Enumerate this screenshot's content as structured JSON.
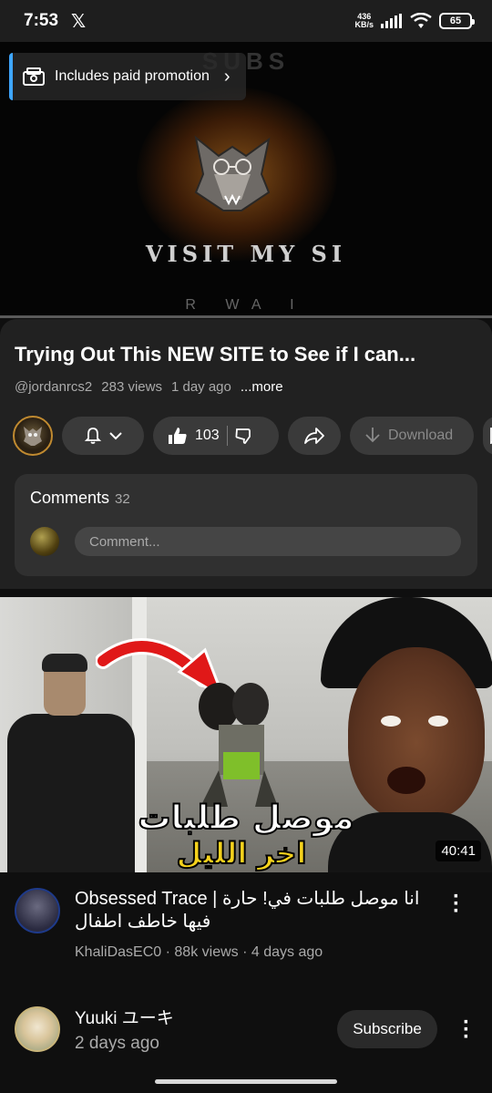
{
  "status_bar": {
    "time": "7:53",
    "x_logo": "𝕏",
    "net_speed_value": "436",
    "net_speed_unit": "KB/s",
    "battery": "65"
  },
  "player": {
    "promo_label": "Includes paid promotion",
    "overlay_top_text": "SUBS",
    "overlay_visit_text": "VISIT MY SI",
    "overlay_bottom_text": "R WA I"
  },
  "video": {
    "title": "Trying Out This NEW SITE to See if I can...",
    "channel_handle": "@jordanrcs2",
    "views": "283 views",
    "age": "1 day ago",
    "more_label": "...more",
    "likes": "103",
    "download_label": "Download"
  },
  "comments": {
    "label": "Comments",
    "count": "32",
    "placeholder": "Comment..."
  },
  "recommended": {
    "thumb_arabic_line1": "موصل طلبات",
    "thumb_arabic_line2": "اخر الليل",
    "duration": "40:41",
    "title": "Obsessed Trace | انا موصل طلبات في! حارة فيها خاطف اطفال",
    "channel": "KhaliDasEC0",
    "views": "88k views",
    "age": "4 days ago"
  },
  "channel_row": {
    "name": "Yuuki ユーキ",
    "time": "2 days ago",
    "subscribe_label": "Subscribe"
  },
  "colors": {
    "accent": "#3ea6ff",
    "background": "#0f0f0f",
    "panel": "#212121",
    "pill": "#3a3a3a"
  }
}
